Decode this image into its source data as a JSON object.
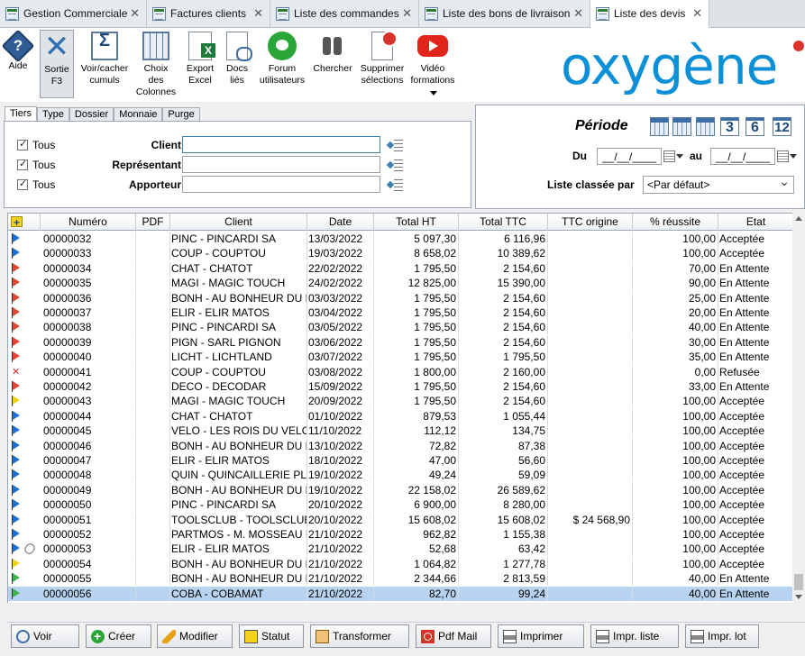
{
  "tabs": [
    {
      "label": "Gestion Commerciale",
      "active": false
    },
    {
      "label": "Factures clients",
      "active": false
    },
    {
      "label": "Liste des commandes",
      "active": false
    },
    {
      "label": "Liste des bons de livraison",
      "active": false
    },
    {
      "label": "Liste des devis",
      "active": true
    }
  ],
  "toolbar": {
    "help": "Aide",
    "exit_line1": "Sortie",
    "exit_line2": "F3",
    "cumuls_line1": "Voir/cacher",
    "cumuls_line2": "cumuls",
    "cols_line1": "Choix",
    "cols_line2": "des",
    "cols_line3": "Colonnes",
    "excel_line1": "Export",
    "excel_line2": "Excel",
    "docs_line1": "Docs",
    "docs_line2": "liés",
    "forum_line1": "Forum",
    "forum_line2": "utilisateurs",
    "search": "Chercher",
    "delete_line1": "Supprimer",
    "delete_line2": "sélections",
    "video_line1": "Vidéo",
    "video_line2": "formations"
  },
  "logo": "oxygène",
  "filter_tabs": [
    "Tiers",
    "Type",
    "Dossier",
    "Monnaie",
    "Purge"
  ],
  "filters": [
    {
      "check_label": "Tous",
      "label": "Client",
      "value": ""
    },
    {
      "check_label": "Tous",
      "label": "Représentant",
      "value": ""
    },
    {
      "check_label": "Tous",
      "label": "Apporteur",
      "value": ""
    }
  ],
  "period": {
    "title": "Période",
    "cal_numbers": [
      "3",
      "6",
      "12"
    ],
    "from_label": "Du",
    "from_value": "__/__/____",
    "to_label": "au",
    "to_value": "__/__/____",
    "sort_label": "Liste classée par",
    "sort_value": "<Par défaut>"
  },
  "grid": {
    "headers": [
      "Numéro",
      "PDF",
      "Client",
      "Date",
      "Total HT",
      "Total TTC",
      "TTC origine",
      "% réussite",
      "Etat"
    ],
    "rows": [
      {
        "flag": "blue",
        "num": "00000032",
        "client": "PINC - PINCARDI SA",
        "date": "13/03/2022",
        "ht": "5 097,30",
        "ttc": "6 116,96",
        "orig": "",
        "pct": "100,00",
        "etat": "Acceptée"
      },
      {
        "flag": "blue",
        "num": "00000033",
        "client": "COUP - COUPTOU",
        "date": "19/03/2022",
        "ht": "8 658,02",
        "ttc": "10 389,62",
        "orig": "",
        "pct": "100,00",
        "etat": "Acceptée"
      },
      {
        "flag": "red",
        "num": "00000034",
        "client": "CHAT - CHATOT",
        "date": "22/02/2022",
        "ht": "1 795,50",
        "ttc": "2 154,60",
        "orig": "",
        "pct": "70,00",
        "etat": "En Attente"
      },
      {
        "flag": "red",
        "num": "00000035",
        "client": "MAGI - MAGIC TOUCH",
        "date": "24/02/2022",
        "ht": "12 825,00",
        "ttc": "15 390,00",
        "orig": "",
        "pct": "90,00",
        "etat": "En Attente"
      },
      {
        "flag": "red",
        "num": "00000036",
        "client": "BONH - AU BONHEUR DU D",
        "date": "03/03/2022",
        "ht": "1 795,50",
        "ttc": "2 154,60",
        "orig": "",
        "pct": "25,00",
        "etat": "En Attente"
      },
      {
        "flag": "red",
        "num": "00000037",
        "client": "ELIR - ELIR MATOS",
        "date": "03/04/2022",
        "ht": "1 795,50",
        "ttc": "2 154,60",
        "orig": "",
        "pct": "20,00",
        "etat": "En Attente"
      },
      {
        "flag": "red",
        "num": "00000038",
        "client": "PINC - PINCARDI SA",
        "date": "03/05/2022",
        "ht": "1 795,50",
        "ttc": "2 154,60",
        "orig": "",
        "pct": "40,00",
        "etat": "En Attente"
      },
      {
        "flag": "red",
        "num": "00000039",
        "client": "PIGN - SARL PIGNON",
        "date": "03/06/2022",
        "ht": "1 795,50",
        "ttc": "2 154,60",
        "orig": "",
        "pct": "30,00",
        "etat": "En Attente"
      },
      {
        "flag": "red",
        "num": "00000040",
        "client": "LICHT - LICHTLAND",
        "date": "03/07/2022",
        "ht": "1 795,50",
        "ttc": "1 795,50",
        "orig": "",
        "pct": "35,00",
        "etat": "En Attente"
      },
      {
        "flag": "refused",
        "num": "00000041",
        "client": "COUP - COUPTOU",
        "date": "03/08/2022",
        "ht": "1 800,00",
        "ttc": "2 160,00",
        "orig": "",
        "pct": "0,00",
        "etat": "Refusée"
      },
      {
        "flag": "red",
        "num": "00000042",
        "client": "DECO - DECODAR",
        "date": "15/09/2022",
        "ht": "1 795,50",
        "ttc": "2 154,60",
        "orig": "",
        "pct": "33,00",
        "etat": "En Attente"
      },
      {
        "flag": "yellow",
        "num": "00000043",
        "client": "MAGI - MAGIC TOUCH",
        "date": "20/09/2022",
        "ht": "1 795,50",
        "ttc": "2 154,60",
        "orig": "",
        "pct": "100,00",
        "etat": "Acceptée"
      },
      {
        "flag": "blue",
        "num": "00000044",
        "client": "CHAT - CHATOT",
        "date": "01/10/2022",
        "ht": "879,53",
        "ttc": "1 055,44",
        "orig": "",
        "pct": "100,00",
        "etat": "Acceptée"
      },
      {
        "flag": "blue",
        "num": "00000045",
        "client": "VELO - LES ROIS DU VELO",
        "date": "11/10/2022",
        "ht": "112,12",
        "ttc": "134,75",
        "orig": "",
        "pct": "100,00",
        "etat": "Acceptée"
      },
      {
        "flag": "blue",
        "num": "00000046",
        "client": "BONH - AU BONHEUR DU D",
        "date": "13/10/2022",
        "ht": "72,82",
        "ttc": "87,38",
        "orig": "",
        "pct": "100,00",
        "etat": "Acceptée"
      },
      {
        "flag": "blue",
        "num": "00000047",
        "client": "ELIR - ELIR MATOS",
        "date": "18/10/2022",
        "ht": "47,00",
        "ttc": "56,60",
        "orig": "",
        "pct": "100,00",
        "etat": "Acceptée"
      },
      {
        "flag": "blue",
        "num": "00000048",
        "client": "QUIN - QUINCAILLERIE PL",
        "date": "19/10/2022",
        "ht": "49,24",
        "ttc": "59,09",
        "orig": "",
        "pct": "100,00",
        "etat": "Acceptée"
      },
      {
        "flag": "blue",
        "num": "00000049",
        "client": "BONH - AU BONHEUR DU D",
        "date": "19/10/2022",
        "ht": "22 158,02",
        "ttc": "26 589,62",
        "orig": "",
        "pct": "100,00",
        "etat": "Acceptée"
      },
      {
        "flag": "blue",
        "num": "00000050",
        "client": "PINC - PINCARDI SA",
        "date": "20/10/2022",
        "ht": "6 900,00",
        "ttc": "8 280,00",
        "orig": "",
        "pct": "100,00",
        "etat": "Acceptée"
      },
      {
        "flag": "blue",
        "num": "00000051",
        "client": "TOOLSCLUB - TOOLSCLUB",
        "date": "20/10/2022",
        "ht": "15 608,02",
        "ttc": "15 608,02",
        "orig": "$ 24 568,90",
        "pct": "100,00",
        "etat": "Acceptée"
      },
      {
        "flag": "blue",
        "num": "00000052",
        "client": "PARTMOS - M. MOSSEAU E",
        "date": "21/10/2022",
        "ht": "962,82",
        "ttc": "1 155,38",
        "orig": "",
        "pct": "100,00",
        "etat": "Acceptée"
      },
      {
        "flag": "blue",
        "clip": true,
        "num": "00000053",
        "client": "ELIR - ELIR MATOS",
        "date": "21/10/2022",
        "ht": "52,68",
        "ttc": "63,42",
        "orig": "",
        "pct": "100,00",
        "etat": "Acceptée"
      },
      {
        "flag": "yellow",
        "num": "00000054",
        "client": "BONH - AU BONHEUR DU D",
        "date": "21/10/2022",
        "ht": "1 064,82",
        "ttc": "1 277,78",
        "orig": "",
        "pct": "100,00",
        "etat": "Acceptée"
      },
      {
        "flag": "green",
        "num": "00000055",
        "client": "BONH - AU BONHEUR DU D",
        "date": "21/10/2022",
        "ht": "2 344,66",
        "ttc": "2 813,59",
        "orig": "",
        "pct": "40,00",
        "etat": "En Attente"
      },
      {
        "flag": "green",
        "num": "00000056",
        "client": "COBA - COBAMAT",
        "date": "21/10/2022",
        "ht": "82,70",
        "ttc": "99,24",
        "orig": "",
        "pct": "40,00",
        "etat": "En Attente",
        "selected": true
      }
    ]
  },
  "flag_colors": {
    "blue": "#1f6fd1",
    "red": "#e0472f",
    "yellow": "#f2d21b",
    "green": "#39b54a"
  },
  "bottom_buttons": [
    {
      "label": "Voir",
      "icon": "eye-icon"
    },
    {
      "label": "Créer",
      "icon": "plus-icon"
    },
    {
      "label": "Modifier",
      "icon": "pencil-icon"
    },
    {
      "label": "Statut",
      "icon": "status-icon"
    },
    {
      "label": "Transformer",
      "icon": "transform-icon"
    },
    {
      "label": "Pdf Mail",
      "icon": "pdf-icon"
    },
    {
      "label": "Imprimer",
      "icon": "printer-icon"
    },
    {
      "label": "Impr. liste",
      "icon": "printer-icon"
    },
    {
      "label": "Impr. lot",
      "icon": "printer-icon"
    }
  ]
}
